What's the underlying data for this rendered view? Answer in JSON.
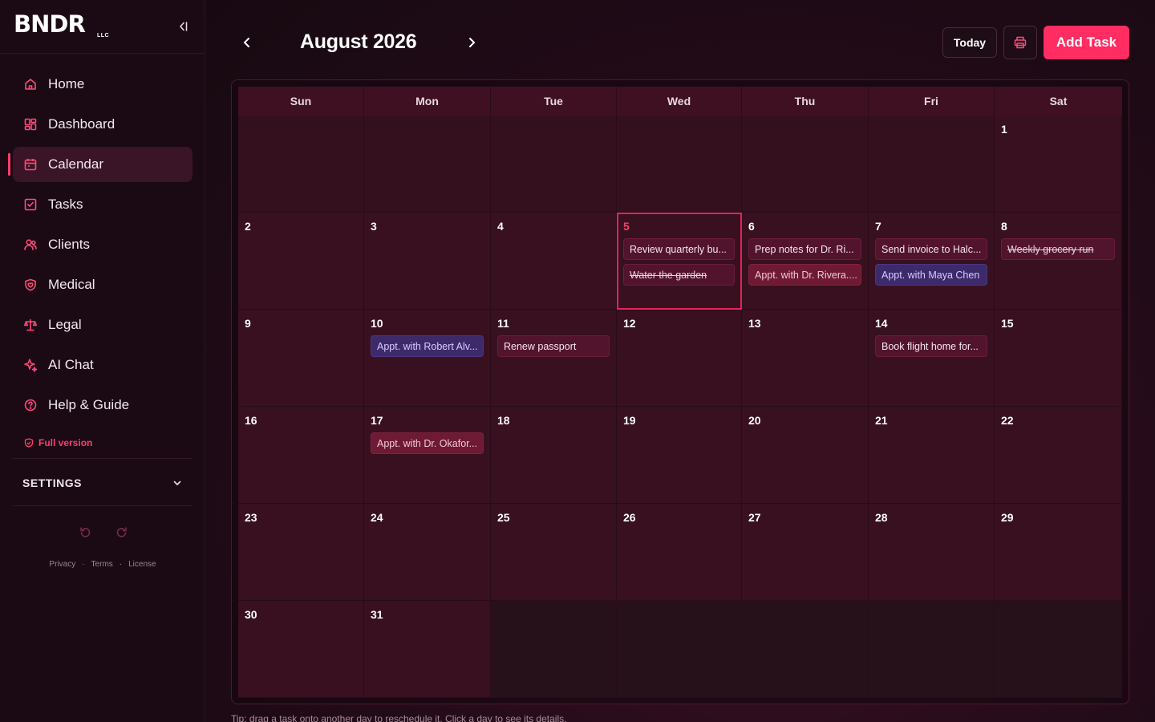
{
  "brand": {
    "logo": "BNDR",
    "suffix": "LLC"
  },
  "sidebar": {
    "items": [
      {
        "label": "Home",
        "icon": "home-icon"
      },
      {
        "label": "Dashboard",
        "icon": "dashboard-icon"
      },
      {
        "label": "Calendar",
        "icon": "calendar-icon",
        "active": true
      },
      {
        "label": "Tasks",
        "icon": "tasks-icon"
      },
      {
        "label": "Clients",
        "icon": "clients-icon"
      },
      {
        "label": "Medical",
        "icon": "medical-icon"
      },
      {
        "label": "Legal",
        "icon": "legal-icon"
      },
      {
        "label": "AI Chat",
        "icon": "ai-chat-icon"
      },
      {
        "label": "Help & Guide",
        "icon": "help-icon"
      }
    ],
    "full_version": "Full version",
    "settings_label": "SETTINGS",
    "footer": {
      "privacy": "Privacy",
      "terms": "Terms",
      "license": "License"
    }
  },
  "header": {
    "month_title": "August 2026",
    "today_label": "Today",
    "add_task_label": "Add Task"
  },
  "calendar": {
    "weekdays": [
      "Sun",
      "Mon",
      "Tue",
      "Wed",
      "Thu",
      "Fri",
      "Sat"
    ],
    "weeks": [
      [
        {
          "day": "",
          "tasks": []
        },
        {
          "day": "",
          "tasks": []
        },
        {
          "day": "",
          "tasks": []
        },
        {
          "day": "",
          "tasks": []
        },
        {
          "day": "",
          "tasks": []
        },
        {
          "day": "",
          "tasks": []
        },
        {
          "day": "1",
          "tasks": []
        }
      ],
      [
        {
          "day": "2",
          "tasks": []
        },
        {
          "day": "3",
          "tasks": []
        },
        {
          "day": "4",
          "tasks": []
        },
        {
          "day": "5",
          "today": true,
          "tasks": [
            {
              "text": "Review quarterly bu...",
              "style": "task"
            },
            {
              "text": "Water the garden",
              "style": "task done"
            }
          ]
        },
        {
          "day": "6",
          "tasks": [
            {
              "text": "Prep notes for Dr. Ri...",
              "style": "task"
            },
            {
              "text": "Appt. with Dr. Rivera....",
              "style": "task appt-red"
            }
          ]
        },
        {
          "day": "7",
          "tasks": [
            {
              "text": "Send invoice to Halc...",
              "style": "task"
            },
            {
              "text": "Appt. with Maya Chen",
              "style": "task appt-purple"
            }
          ]
        },
        {
          "day": "8",
          "tasks": [
            {
              "text": "Weekly grocery run",
              "style": "task done"
            }
          ]
        }
      ],
      [
        {
          "day": "9",
          "tasks": []
        },
        {
          "day": "10",
          "tasks": [
            {
              "text": "Appt. with Robert Alv...",
              "style": "task appt-purple"
            }
          ]
        },
        {
          "day": "11",
          "tasks": [
            {
              "text": "Renew passport",
              "style": "task"
            }
          ]
        },
        {
          "day": "12",
          "tasks": []
        },
        {
          "day": "13",
          "tasks": []
        },
        {
          "day": "14",
          "tasks": [
            {
              "text": "Book flight home for...",
              "style": "task"
            }
          ]
        },
        {
          "day": "15",
          "tasks": []
        }
      ],
      [
        {
          "day": "16",
          "tasks": []
        },
        {
          "day": "17",
          "tasks": [
            {
              "text": "Appt. with Dr. Okafor...",
              "style": "task appt-red"
            }
          ]
        },
        {
          "day": "18",
          "tasks": []
        },
        {
          "day": "19",
          "tasks": []
        },
        {
          "day": "20",
          "tasks": []
        },
        {
          "day": "21",
          "tasks": []
        },
        {
          "day": "22",
          "tasks": []
        }
      ],
      [
        {
          "day": "23",
          "tasks": []
        },
        {
          "day": "24",
          "tasks": []
        },
        {
          "day": "25",
          "tasks": []
        },
        {
          "day": "26",
          "tasks": []
        },
        {
          "day": "27",
          "tasks": []
        },
        {
          "day": "28",
          "tasks": []
        },
        {
          "day": "29",
          "tasks": []
        }
      ],
      [
        {
          "day": "30",
          "tasks": []
        },
        {
          "day": "31",
          "tasks": []
        },
        {
          "day": "",
          "blank": true,
          "tasks": []
        },
        {
          "day": "",
          "blank": true,
          "tasks": []
        },
        {
          "day": "",
          "blank": true,
          "tasks": []
        },
        {
          "day": "",
          "blank": true,
          "tasks": []
        },
        {
          "day": "",
          "blank": true,
          "tasks": []
        }
      ]
    ]
  },
  "tip": "Tip: drag a task onto another day to reschedule it. Click a day to see its details.",
  "colors": {
    "accent": "#ff2d62",
    "sidebar_bg": "#1b0a14",
    "cell_bg": "#38101f"
  }
}
